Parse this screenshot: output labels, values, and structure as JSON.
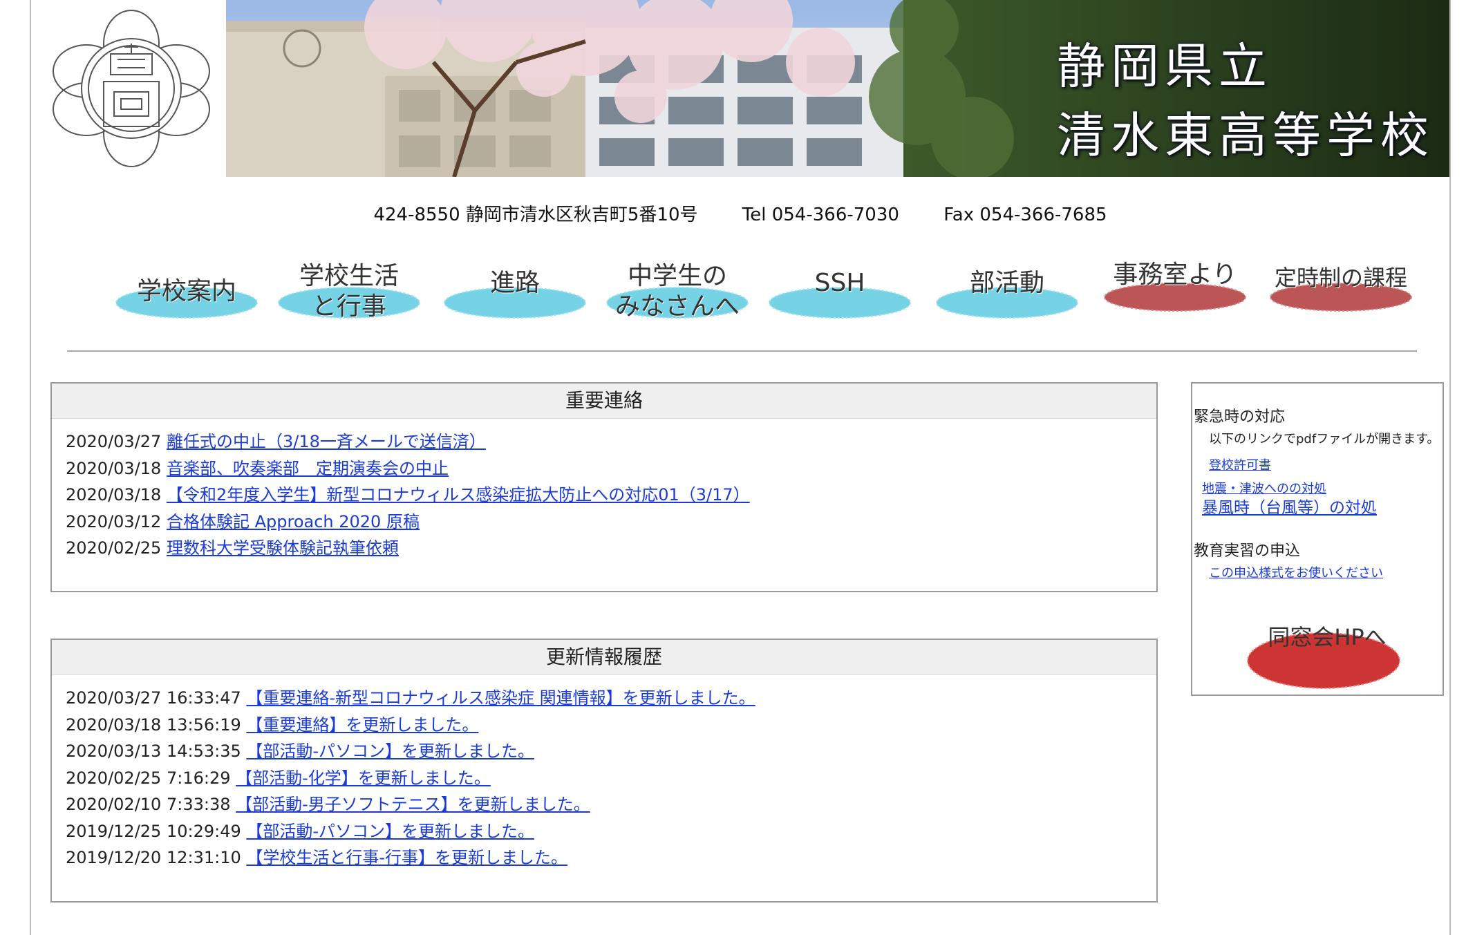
{
  "header": {
    "crest_icon": "school-crest-icon",
    "school_name_line1": "静岡県立",
    "school_name_line2": "清水東高等学校",
    "banner_image": "school-building-with-cherry-blossoms"
  },
  "contact": {
    "address": "424-8550 静岡市清水区秋吉町5番10号",
    "tel": "Tel 054-366-7030",
    "fax": "Fax 054-366-7685"
  },
  "nav": {
    "items": [
      {
        "label": "学校案内",
        "color": "#5ecbe0"
      },
      {
        "label_line1": "学校生活",
        "label_line2": "と行事",
        "color": "#5ecbe0"
      },
      {
        "label": "進路",
        "color": "#5ecbe0"
      },
      {
        "label_line1": "中学生の",
        "label_line2": "みなさんへ",
        "color": "#5ecbe0"
      },
      {
        "label": "SSH",
        "color": "#5ecbe0"
      },
      {
        "label": "部活動",
        "color": "#5ecbe0"
      },
      {
        "label": "事務室より",
        "color": "#b03838"
      },
      {
        "label": "定時制の課程",
        "color": "#b03838"
      }
    ]
  },
  "important": {
    "title": "重要連絡",
    "items": [
      {
        "date": "2020/03/27",
        "text": "離任式の中止（3/18一斉メールで送信済）"
      },
      {
        "date": "2020/03/18",
        "text": "音楽部、吹奏楽部　定期演奏会の中止"
      },
      {
        "date": "2020/03/18",
        "text": "【令和2年度入学生】新型コロナウィルス感染症拡大防止への対応01（3/17）"
      },
      {
        "date": "2020/03/12",
        "text": "合格体験記 Approach 2020 原稿"
      },
      {
        "date": "2020/02/25",
        "text": "理数科大学受験体験記執筆依頼"
      }
    ]
  },
  "updates": {
    "title": "更新情報履歴",
    "items": [
      {
        "date": "2020/03/27 16:33:47",
        "text": "【重要連絡-新型コロナウィルス感染症 関連情報】を更新しました。"
      },
      {
        "date": "2020/03/18 13:56:19",
        "text": "【重要連絡】を更新しました。"
      },
      {
        "date": "2020/03/13 14:53:35",
        "text": "【部活動-パソコン】を更新しました。"
      },
      {
        "date": "2020/02/25 7:16:29",
        "text": "【部活動-化学】を更新しました。"
      },
      {
        "date": "2020/02/10 7:33:38",
        "text": "【部活動-男子ソフトテニス】を更新しました。"
      },
      {
        "date": "2019/12/25 10:29:49",
        "text": "【部活動-パソコン】を更新しました。"
      },
      {
        "date": "2019/12/20 12:31:10",
        "text": "【学校生活と行事-行事】を更新しました。"
      }
    ]
  },
  "sidebar": {
    "emergency_title": "緊急時の対応",
    "emergency_note": "以下のリンクでpdfファイルが開きます。",
    "link_attendance": "登校許可書",
    "link_earthquake": "地震・津波へのの対処",
    "link_storm": "暴風時（台風等）の対処",
    "practicum_title": "教育実習の申込",
    "link_practicum": "この申込様式をお使いください",
    "alumni_label": "同窓会HPへ",
    "alumni_color": "#c81e1e"
  },
  "colors": {
    "link": "#1a3bd6",
    "panel_header_bg": "#efefef",
    "nav_blue": "#5ecbe0",
    "nav_red": "#b03838"
  }
}
